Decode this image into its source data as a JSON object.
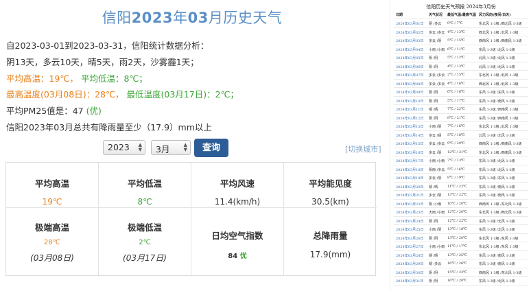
{
  "title": {
    "city": "信阳",
    "year": "2023",
    "year_suffix": "年",
    "month": "03",
    "rest": "月历史天气"
  },
  "summary": {
    "range": "自2023-03-01到2023-03-31，信阳统计数据分析：",
    "days": "阴13天，多云10天，晴5天，雨2天，沙雾霾1天；",
    "avg_temps": {
      "high": "平均高温：19℃，",
      "low": "平均低温：8℃；"
    },
    "extreme_temps": {
      "high": "最高温度(03月08日)：28℃，",
      "low": "最低温度(03月17日)：2℃；"
    },
    "pm25": {
      "text": "平均PM25值是：47 ",
      "quality": "(优)"
    },
    "rain": "信阳2023年03月总共有降雨量至少（17.9）mm以上"
  },
  "controls": {
    "year": "2023",
    "month": "3月",
    "query_label": "查询",
    "switch_city": "[切换城市]"
  },
  "stats": {
    "avg_high": {
      "label": "平均高温",
      "value": "19℃"
    },
    "avg_low": {
      "label": "平均低温",
      "value": "8℃"
    },
    "avg_wind": {
      "label": "平均风速",
      "value": "11.4(km/h)"
    },
    "avg_visibility": {
      "label": "平均能见度",
      "value": "30.5(km)"
    },
    "extreme_high": {
      "label": "极端高温",
      "value": "28℃",
      "date": "(03月08日)"
    },
    "extreme_low": {
      "label": "极端低温",
      "value": "2℃",
      "date": "(03月17日)"
    },
    "aqi": {
      "label": "日均空气指数",
      "value": "84",
      "quality": "优"
    },
    "rain": {
      "label": "总降雨量",
      "value": "17.9(mm)"
    }
  },
  "forecast": {
    "title": "信阳历史天气预报 2024年3月份",
    "headers": [
      "日期",
      "天气状况",
      "最低气温/最高气温",
      "风力风向(夜间/白天)"
    ],
    "rows": [
      [
        "2024年03月01日",
        "阴 /多云",
        "0℃ / 7℃",
        "东北风 1-3级 /西北风 1-3级"
      ],
      [
        "2024年03月02日",
        "多云 /多云",
        "4℃ / 13℃",
        "西北风 1-3级 /北风 1-3级"
      ],
      [
        "2024年03月03日",
        "多云 /阴",
        "5℃ / 15℃",
        "西南风 1-3级 /西南风 1-3级"
      ],
      [
        "2024年03月04日",
        "小雨 /小雨",
        "6℃ / 11℃",
        "东风 1-3级 /北风 1-3级"
      ],
      [
        "2024年03月05日",
        "阴 /阴",
        "5℃ / 12℃",
        "北风 1-3级 /北风 1-3级"
      ],
      [
        "2024年03月06日",
        "阴 /阴",
        "4℃ / 13℃",
        "北风 1-3级 /北风 1-3级"
      ],
      [
        "2024年03月07日",
        "多云 /多云",
        "2℃ / 15℃",
        "东北风 1-3级 /北风 1-3级"
      ],
      [
        "2024年03月08日",
        "多云 /多云",
        "4℃ / 16℃",
        "西北风 1-3级 /北风 1-3级"
      ],
      [
        "2024年03月09日",
        "阴 /阴",
        "6℃ / 16℃",
        "东风 1-3级 /东风 1-3级"
      ],
      [
        "2024年03月10日",
        "阴 /阴",
        "5℃ / 17℃",
        "东风 1-3级 /南风 1-3级"
      ],
      [
        "2024年03月11日",
        "晴 /晴",
        "7℃ / 22℃",
        "东风 1-3级 /西南风 1-3级"
      ],
      [
        "2024年03月12日",
        "阴 /阴",
        "8℃ / 21℃",
        "东风 1-3级 /西南风 1-3级"
      ],
      [
        "2024年03月13日",
        "小雨 /阴",
        "7℃ / 16℃",
        "东北风 1-3级 /北风 1-3级"
      ],
      [
        "2024年03月14日",
        "多云 /晴",
        "5℃ / 18℃",
        "北风 1-3级 /北风 1-3级"
      ],
      [
        "2024年03月15日",
        "多云 /多云",
        "9℃ / 20℃",
        "西南风 1-3级 /西南风 1-3级"
      ],
      [
        "2024年03月16日",
        "多云 /阴",
        "12℃ / 21℃",
        "东北风 1-3级 /西南风 1-3级"
      ],
      [
        "2024年03月17日",
        "小雨 /小雨",
        "7℃ / 13℃",
        "东风 1-3级 /北风 1-3级"
      ],
      [
        "2024年03月18日",
        "阴雨 /多云",
        "5℃ / 16℃",
        "东风 1-3级 /北风 1-3级"
      ],
      [
        "2024年03月19日",
        "多云 /阴",
        "8℃ / 19℃",
        "东风 1-3级 /东风 1-3级"
      ],
      [
        "2024年03月20日",
        "晴 /晴",
        "11℃ / 22℃",
        "东风 1-3级 /南风 1-3级"
      ],
      [
        "2024年03月21日",
        "多云 /阴",
        "13℃ / 22℃",
        "东风 1-3级 /南风 1-3级"
      ],
      [
        "2024年03月22日",
        "阴 /小雨",
        "10℃ / 20℃",
        "西南风 1-3级 /东北风 1-3级"
      ],
      [
        "2024年03月23日",
        "大雨 /小雨",
        "12℃ / 20℃",
        "东北风 1-3级 /西北风 1-3级"
      ],
      [
        "2024年03月24日",
        "阴 /阴",
        "12℃ / 22℃",
        "东风 1-3级 /北风 1-3级"
      ],
      [
        "2024年03月25日",
        "小雨 /阴",
        "13℃ / 18℃",
        "东风 1-3级 /北风 1-3级"
      ],
      [
        "2024年03月26日",
        "阴 /阴",
        "13℃ / 20℃",
        "东北风 1-3级 /东风 1-3级"
      ],
      [
        "2024年03月27日",
        "小雨 /小雨",
        "11℃ / 17℃",
        "东北风 1-3级 /东风 1-3级"
      ],
      [
        "2024年03月28日",
        "晴 /晴",
        "13℃ / 25℃",
        "东风 1-3级 /南风 1-3级"
      ],
      [
        "2024年03月29日",
        "晴 /多云",
        "16℃ / 26℃",
        "东风 1-3级 /南风 1-3级"
      ],
      [
        "2024年03月30日",
        "阴 /阴",
        "15℃ / 23℃",
        "西南风 1-3级 /东北风 1-3级"
      ],
      [
        "2024年03月31日",
        "阴 /阴",
        "16℃ / 20℃",
        "东风 1-3级 /北风 1-3级"
      ]
    ]
  }
}
